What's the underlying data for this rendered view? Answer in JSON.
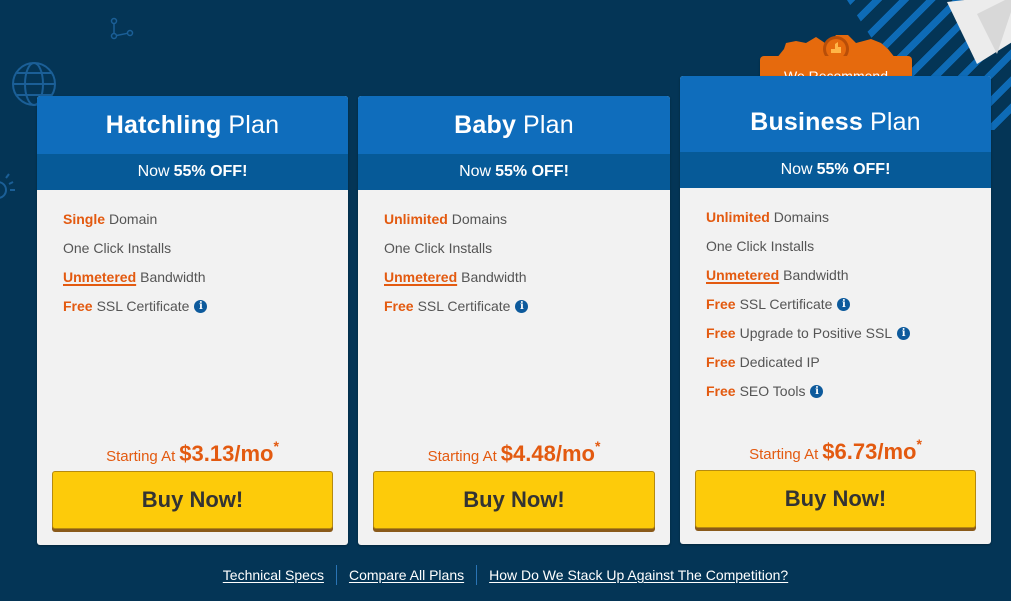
{
  "badge": {
    "label": "We Recommend",
    "icon": "thumbs-up-icon"
  },
  "plans": [
    {
      "name_bold": "Hatchling",
      "name_light": "Plan",
      "discount_prefix": "Now",
      "discount": "55% OFF!",
      "features": [
        {
          "highlight": "Single",
          "text": "Domain",
          "underline": false,
          "info": false
        },
        {
          "highlight": "",
          "text": "One Click Installs",
          "underline": false,
          "info": false
        },
        {
          "highlight": "Unmetered",
          "text": "Bandwidth",
          "underline": true,
          "info": false
        },
        {
          "highlight": "Free",
          "text": "SSL Certificate",
          "underline": false,
          "info": true
        }
      ],
      "price_label": "Starting At",
      "price": "$3.13/mo",
      "price_note": "*",
      "button": "Buy Now!"
    },
    {
      "name_bold": "Baby",
      "name_light": "Plan",
      "discount_prefix": "Now",
      "discount": "55% OFF!",
      "features": [
        {
          "highlight": "Unlimited",
          "text": "Domains",
          "underline": false,
          "info": false
        },
        {
          "highlight": "",
          "text": "One Click Installs",
          "underline": false,
          "info": false
        },
        {
          "highlight": "Unmetered",
          "text": "Bandwidth",
          "underline": true,
          "info": false
        },
        {
          "highlight": "Free",
          "text": "SSL Certificate",
          "underline": false,
          "info": true
        }
      ],
      "price_label": "Starting At",
      "price": "$4.48/mo",
      "price_note": "*",
      "button": "Buy Now!"
    },
    {
      "name_bold": "Business",
      "name_light": "Plan",
      "discount_prefix": "Now",
      "discount": "55% OFF!",
      "features": [
        {
          "highlight": "Unlimited",
          "text": "Domains",
          "underline": false,
          "info": false
        },
        {
          "highlight": "",
          "text": "One Click Installs",
          "underline": false,
          "info": false
        },
        {
          "highlight": "Unmetered",
          "text": "Bandwidth",
          "underline": true,
          "info": false
        },
        {
          "highlight": "Free",
          "text": "SSL Certificate",
          "underline": false,
          "info": true
        },
        {
          "highlight": "Free",
          "text": "Upgrade to Positive SSL",
          "underline": false,
          "info": true
        },
        {
          "highlight": "Free",
          "text": "Dedicated IP",
          "underline": false,
          "info": false
        },
        {
          "highlight": "Free",
          "text": "SEO Tools",
          "underline": false,
          "info": true
        }
      ],
      "price_label": "Starting At",
      "price": "$6.73/mo",
      "price_note": "*",
      "button": "Buy Now!"
    }
  ],
  "footer_links": [
    "Technical Specs",
    "Compare All Plans",
    "How Do We Stack Up Against The Competition?"
  ],
  "colors": {
    "background": "#043556",
    "header_blue": "#0f6dbc",
    "sub_blue": "#065a98",
    "accent_orange": "#e35a10",
    "button_yellow": "#fdcb0a",
    "badge_orange": "#e66a0d"
  }
}
